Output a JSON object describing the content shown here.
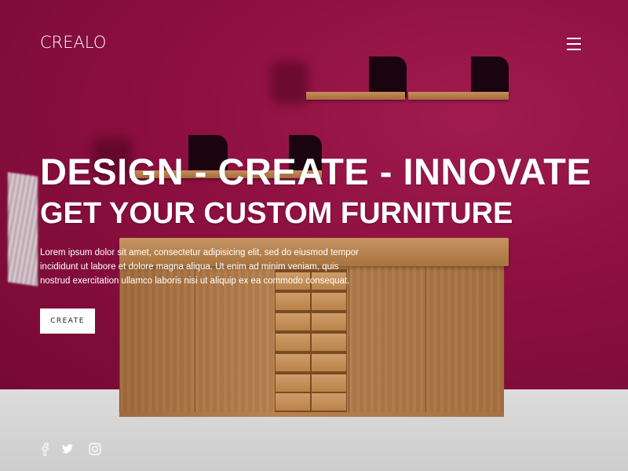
{
  "header": {
    "brand": "CREALO",
    "menu_icon": "hamburger-menu-icon"
  },
  "hero": {
    "headline": "DESIGN - CREATE - INNOVATE",
    "subheadline": "GET YOUR CUSTOM FURNITURE",
    "paragraph": "Lorem ipsum dolor sit amet, consectetur adipisicing elit, sed do eiusmod tempor incididunt ut labore et dolore magna aliqua. Ut enim ad minim veniam, quis nostrud exercitation ullamco laboris nisi ut aliquip ex ea commodo consequat.",
    "cta_label": "CREATE"
  },
  "social": [
    {
      "icon": "facebook-icon"
    },
    {
      "icon": "twitter-icon"
    },
    {
      "icon": "instagram-icon"
    }
  ],
  "colors": {
    "wall": "#8c0f40",
    "floor": "#d5d5d5",
    "wood": "#b88150",
    "text": "#ffffff",
    "button_bg": "#ffffff",
    "button_text": "#222222"
  }
}
